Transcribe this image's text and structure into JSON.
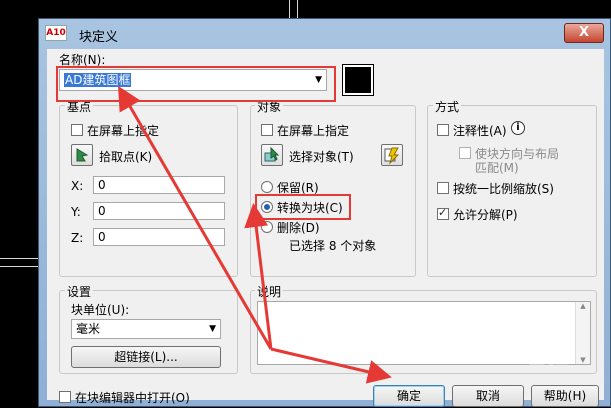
{
  "dialog": {
    "title": "块定义",
    "app_icon_text": "A10",
    "close_label": "X"
  },
  "name": {
    "label": "名称(N):",
    "value": "AD建筑图框"
  },
  "base_point": {
    "title": "基点",
    "specify_on_screen": "在屏幕上指定",
    "pick_point": "拾取点(K)",
    "x_label": "X:",
    "x_value": "0",
    "y_label": "Y:",
    "y_value": "0",
    "z_label": "Z:",
    "z_value": "0"
  },
  "objects": {
    "title": "对象",
    "specify_on_screen": "在屏幕上指定",
    "select_objects": "选择对象(T)",
    "retain": "保留(R)",
    "convert_to_block": "转换为块(C)",
    "delete": "删除(D)",
    "selected_status": "已选择 8 个对象"
  },
  "behavior": {
    "title": "方式",
    "annotative": "注释性(A)",
    "match_orientation": "使块方向与布局",
    "match_orientation_2": "匹配(M)",
    "scale_uniformly": "按统一比例缩放(S)",
    "allow_exploding": "允许分解(P)"
  },
  "settings": {
    "title": "设置",
    "block_unit_label": "块单位(U):",
    "block_unit_value": "毫米",
    "hyperlink_button": "超链接(L)..."
  },
  "description": {
    "title": "说明"
  },
  "footer": {
    "open_in_editor": "在块编辑器中打开(O)",
    "ok": "确定",
    "cancel": "取消",
    "help": "帮助(H)"
  },
  "colors": {
    "annotation_red": "#e53935",
    "selection_blue": "#3a78d6"
  },
  "state": {
    "base_specify_checked": false,
    "objects_specify_checked": false,
    "annotative_checked": false,
    "match_orientation_checked": false,
    "scale_uniformly_checked": false,
    "allow_exploding_checked": true,
    "open_in_editor_checked": false,
    "selected_object_mode": "convert_to_block"
  }
}
